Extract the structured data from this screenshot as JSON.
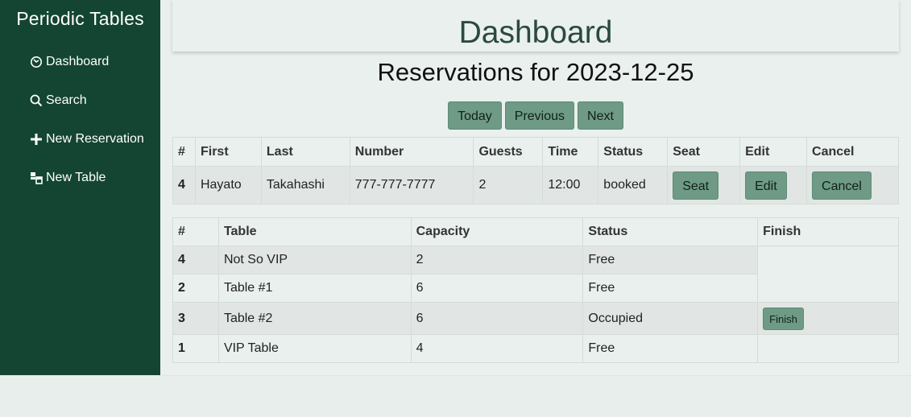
{
  "sidebar": {
    "brand": "Periodic Tables",
    "items": [
      {
        "label": "Dashboard",
        "icon": "dashboard-icon"
      },
      {
        "label": "Search",
        "icon": "search-icon"
      },
      {
        "label": "New Reservation",
        "icon": "plus-icon"
      },
      {
        "label": "New Table",
        "icon": "table-icon"
      }
    ]
  },
  "header": {
    "title": "Dashboard"
  },
  "reservations": {
    "title": "Reservations for 2023-12-25",
    "nav": {
      "today": "Today",
      "previous": "Previous",
      "next": "Next"
    },
    "columns": [
      "#",
      "First",
      "Last",
      "Number",
      "Guests",
      "Time",
      "Status",
      "Seat",
      "Edit",
      "Cancel"
    ],
    "rows": [
      {
        "id": "4",
        "first": "Hayato",
        "last": "Takahashi",
        "number": "777-777-7777",
        "guests": "2",
        "time": "12:00",
        "status": "booked",
        "seat": "Seat",
        "edit": "Edit",
        "cancel": "Cancel"
      }
    ]
  },
  "tables": {
    "columns": [
      "#",
      "Table",
      "Capacity",
      "Status",
      "Finish"
    ],
    "rows": [
      {
        "id": "4",
        "name": "Not So VIP",
        "capacity": "2",
        "status": "Free",
        "finish": ""
      },
      {
        "id": "2",
        "name": "Table #1",
        "capacity": "6",
        "status": "Free",
        "finish": ""
      },
      {
        "id": "3",
        "name": "Table #2",
        "capacity": "6",
        "status": "Occupied",
        "finish": "Finish"
      },
      {
        "id": "1",
        "name": "VIP Table",
        "capacity": "4",
        "status": "Free",
        "finish": ""
      }
    ]
  },
  "colors": {
    "sidebar_bg": "#134532",
    "page_bg": "#e9f0ed",
    "button_bg": "#6f9a86",
    "heading": "#2b4a3d"
  }
}
